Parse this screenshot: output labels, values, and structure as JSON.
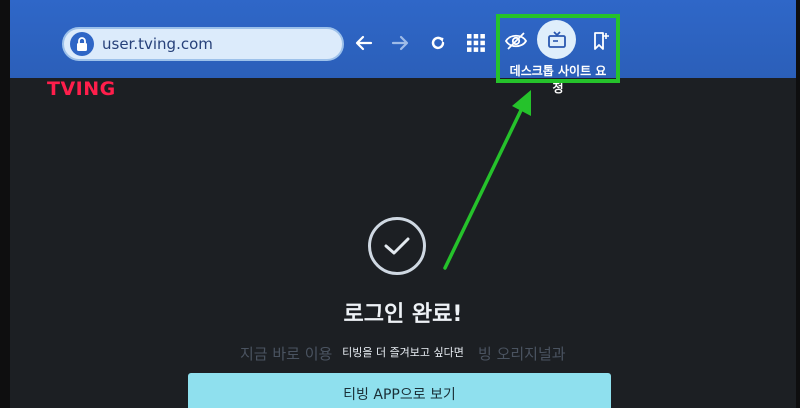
{
  "browser": {
    "url": "user.tving.com",
    "tooltip": "데스크톱 사이트 요청"
  },
  "page": {
    "brand": "TVING",
    "title": "로그인 완료!",
    "subtitle_back_left": "지금 바로 이용",
    "subtitle_front": "티빙을 더 즐겨보고 싶다면",
    "subtitle_back_right": "빙 오리지널과",
    "app_button_label": "티빙 APP으로 보기"
  },
  "colors": {
    "toolbar": "#2f67c8",
    "highlight": "#25c22b",
    "brand": "#ff1e4b",
    "button": "#8fe0ee",
    "background": "#1c1f23"
  }
}
